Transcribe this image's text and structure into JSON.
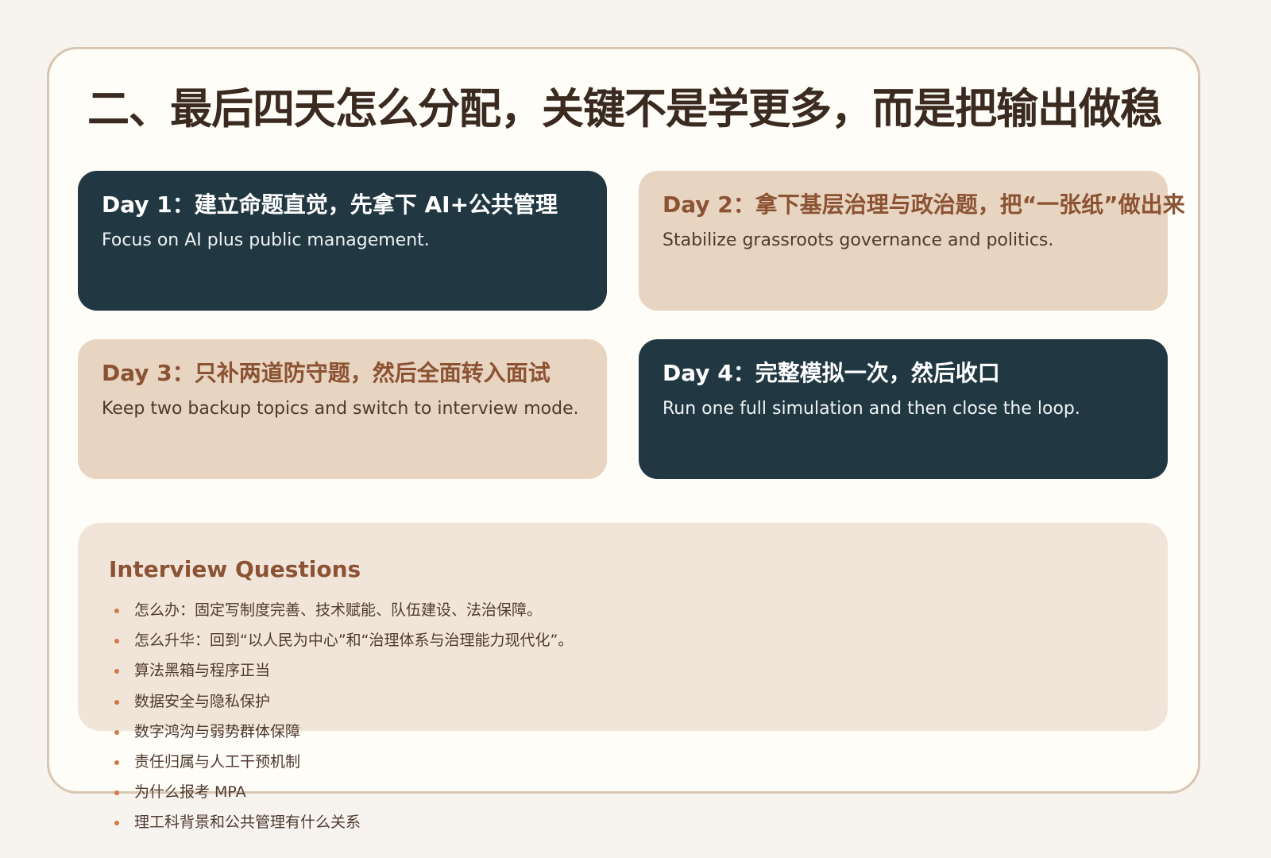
{
  "page": {
    "title": "二、最后四天怎么分配，关键不是学更多，而是把输出做稳"
  },
  "days": [
    {
      "title": "Day 1：建立命题直觉，先拿下 AI+公共管理",
      "description": "Focus on AI plus public management."
    },
    {
      "title": "Day 2：拿下基层治理与政治题，把“一张纸”做出来",
      "description": "Stabilize grassroots governance and politics."
    },
    {
      "title": "Day 3：只补两道防守题，然后全面转入面试",
      "description": "Keep two backup topics and switch to interview mode."
    },
    {
      "title": "Day 4：完整模拟一次，然后收口",
      "description": "Run one full simulation and then close the loop."
    }
  ],
  "interview": {
    "title": "Interview Questions",
    "items": [
      "怎么办：固定写制度完善、技术赋能、队伍建设、法治保障。",
      "怎么升华：回到“以人民为中心”和“治理体系与治理能力现代化”。",
      "算法黑箱与程序正当",
      "数据安全与隐私保护",
      "数字鸿沟与弱势群体保障",
      "责任归属与人工干预机制",
      "为什么报考 MPA",
      "理工科背景和公共管理有什么关系"
    ]
  },
  "colors": {
    "page_background": "#f7f4ef",
    "slide_background": "#fffdf8",
    "slide_border": "#d8c5b2",
    "title_text": "#3a2a20",
    "dark_card": "#213843",
    "light_card": "#e7d4c1",
    "accent_brown": "#8b5233",
    "panel_background": "#f1e5da",
    "bullet": "#d07a45"
  }
}
